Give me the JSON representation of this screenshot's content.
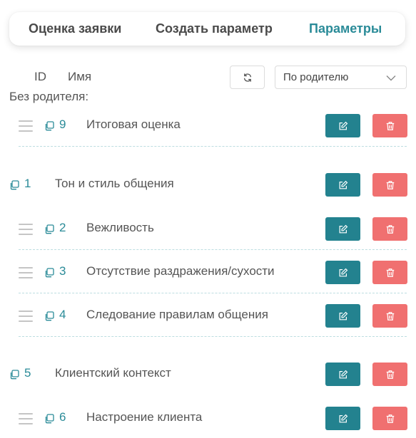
{
  "tabs": [
    {
      "label": "Оценка заявки",
      "active": false
    },
    {
      "label": "Создать параметр",
      "active": false
    },
    {
      "label": "Параметры",
      "active": true
    }
  ],
  "list_header": {
    "id_label": "ID",
    "name_label": "Имя"
  },
  "sort_select": {
    "value": "По родителю"
  },
  "no_parent_label": "Без родителя:",
  "colors": {
    "accent": "#2a8b98",
    "edit": "#23828f",
    "delete": "#f07070"
  },
  "rows": [
    {
      "id": "9",
      "name": "Итоговая оценка",
      "kind": "child"
    },
    {
      "id": "1",
      "name": "Тон и стиль общения",
      "kind": "parent"
    },
    {
      "id": "2",
      "name": "Вежливость",
      "kind": "child"
    },
    {
      "id": "3",
      "name": "Отсутствие раздражения/сухости",
      "kind": "child"
    },
    {
      "id": "4",
      "name": "Следование правилам общения",
      "kind": "child"
    },
    {
      "id": "5",
      "name": "Клиентский контекст",
      "kind": "parent"
    },
    {
      "id": "6",
      "name": "Настроение клиента",
      "kind": "child"
    }
  ]
}
